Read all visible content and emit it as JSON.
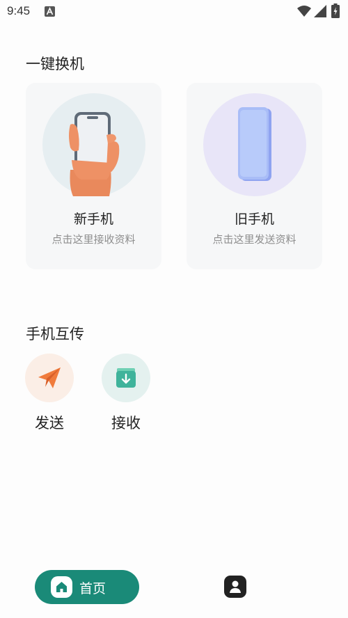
{
  "status_bar": {
    "time": "9:45",
    "icons": [
      "notification-a-icon",
      "wifi-icon",
      "signal-icon",
      "battery-charging-icon"
    ]
  },
  "one_click_switch": {
    "title": "一键换机",
    "new_phone": {
      "title": "新手机",
      "subtitle": "点击这里接收资料"
    },
    "old_phone": {
      "title": "旧手机",
      "subtitle": "点击这里发送资料"
    }
  },
  "phone_transfer": {
    "title": "手机互传",
    "send_label": "发送",
    "receive_label": "接收"
  },
  "bottom_nav": {
    "home_label": "首页",
    "home_icon": "home-icon",
    "profile_icon": "profile-icon"
  },
  "colors": {
    "accent": "#1a8a78",
    "send_orange": "#f07b3c",
    "receive_teal": "#3fb39b"
  }
}
